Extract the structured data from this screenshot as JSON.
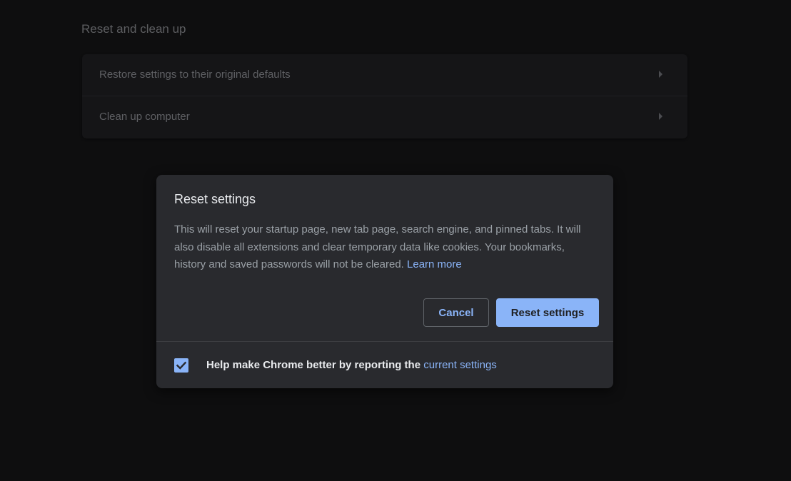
{
  "section": {
    "title": "Reset and clean up",
    "items": [
      {
        "label": "Restore settings to their original defaults",
        "icon": "chevron-right-icon"
      },
      {
        "label": "Clean up computer",
        "icon": "chevron-right-icon"
      }
    ]
  },
  "dialog": {
    "title": "Reset settings",
    "body": "This will reset your startup page, new tab page, search engine, and pinned tabs. It will also disable all extensions and clear temporary data like cookies. Your bookmarks, history and saved passwords will not be cleared.",
    "learn_more": "Learn more",
    "cancel_label": "Cancel",
    "reset_label": "Reset settings",
    "checkbox": {
      "checked": true,
      "icon": "checkmark-icon",
      "label": "Help make Chrome better by reporting the",
      "link": "current settings"
    }
  },
  "colors": {
    "accent": "#8ab4f8",
    "dialog_bg": "#292a2e",
    "page_bg": "#0e0e0f"
  }
}
